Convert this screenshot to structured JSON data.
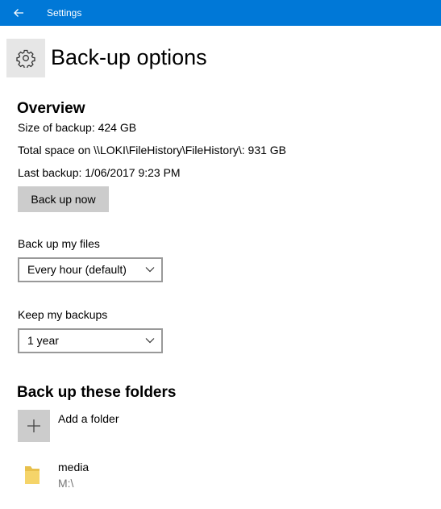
{
  "titlebar": {
    "app_title": "Settings"
  },
  "header": {
    "title": "Back-up options"
  },
  "overview": {
    "heading": "Overview",
    "size_line": "Size of backup: 424 GB",
    "space_line": "Total space on \\\\LOKI\\FileHistory\\FileHistory\\: 931 GB",
    "last_line": "Last backup: 1/06/2017 9:23 PM",
    "backup_button": "Back up now"
  },
  "frequency": {
    "label": "Back up my files",
    "selected": "Every hour (default)"
  },
  "retention": {
    "label": "Keep my backups",
    "selected": "1 year"
  },
  "folders": {
    "heading": "Back up these folders",
    "add_label": "Add a folder",
    "items": [
      {
        "name": "media",
        "path": "M:\\"
      }
    ]
  },
  "colors": {
    "accent": "#0078d7",
    "button_bg": "#cccccc",
    "folder": "#e8c04c"
  }
}
